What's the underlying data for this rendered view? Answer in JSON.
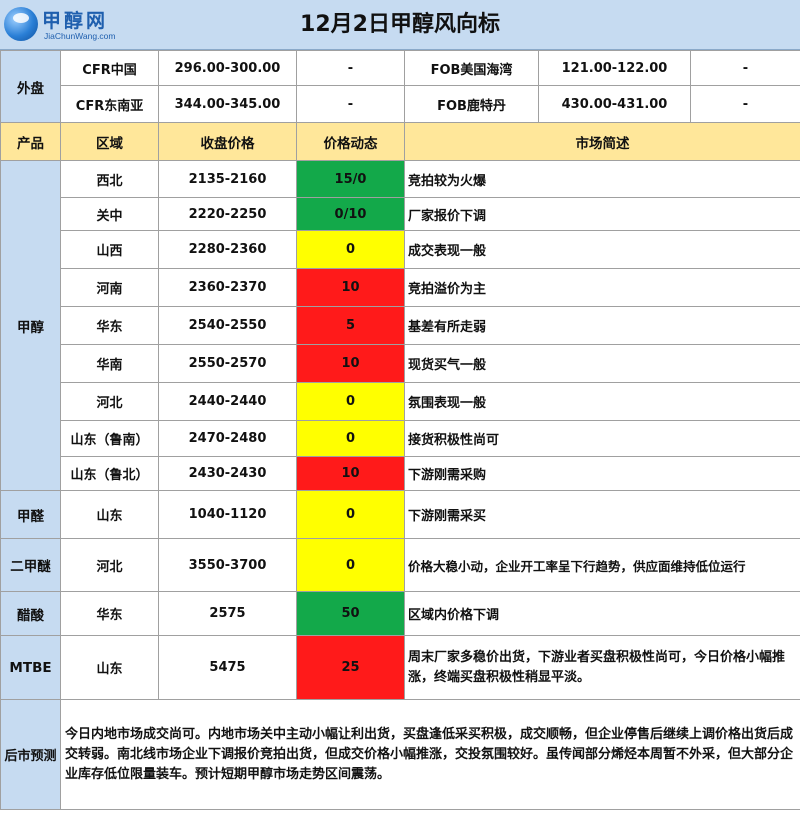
{
  "header": {
    "logo_text": "甲醇网",
    "logo_sub": "JiaChunWang.com",
    "title": "12月2日甲醇风向标"
  },
  "outer": {
    "label": "外盘",
    "rows": [
      {
        "a_name": "CFR中国",
        "a_price": "296.00-300.00",
        "a_change": "-",
        "b_name": "FOB美国海湾",
        "b_price": "121.00-122.00",
        "b_change": "-"
      },
      {
        "a_name": "CFR东南亚",
        "a_price": "344.00-345.00",
        "a_change": "-",
        "b_name": "FOB鹿特丹",
        "b_price": "430.00-431.00",
        "b_change": "-"
      }
    ]
  },
  "columns": {
    "product": "产品",
    "region": "区域",
    "price": "收盘价格",
    "change": "价格动态",
    "comment": "市场简述"
  },
  "products": {
    "methanol": "甲醇",
    "formaldehyde": "甲醛",
    "dme": "二甲醚",
    "acetic": "醋酸",
    "mtbe": "MTBE"
  },
  "rows": [
    {
      "region": "西北",
      "price": "2135-2160",
      "change": "15/0",
      "color": "#13a94a",
      "comment": "竞拍较为火爆"
    },
    {
      "region": "关中",
      "price": "2220-2250",
      "change": "0/10",
      "color": "#13a94a",
      "comment": "厂家报价下调"
    },
    {
      "region": "山西",
      "price": "2280-2360",
      "change": "0",
      "color": "#ffff00",
      "comment": "成交表现一般"
    },
    {
      "region": "河南",
      "price": "2360-2370",
      "change": "10",
      "color": "#ff1a1a",
      "comment": "竞拍溢价为主"
    },
    {
      "region": "华东",
      "price": "2540-2550",
      "change": "5",
      "color": "#ff1a1a",
      "comment": "基差有所走弱"
    },
    {
      "region": "华南",
      "price": "2550-2570",
      "change": "10",
      "color": "#ff1a1a",
      "comment": "现货买气一般"
    },
    {
      "region": "河北",
      "price": "2440-2440",
      "change": "0",
      "color": "#ffff00",
      "comment": "氛围表现一般"
    },
    {
      "region": "山东（鲁南）",
      "price": "2470-2480",
      "change": "0",
      "color": "#ffff00",
      "comment": "接货积极性尚可"
    },
    {
      "region": "山东（鲁北）",
      "price": "2430-2430",
      "change": "10",
      "color": "#ff1a1a",
      "comment": "下游刚需采购"
    },
    {
      "region": "山东",
      "price": "1040-1120",
      "change": "0",
      "color": "#ffff00",
      "comment": "下游刚需采买"
    },
    {
      "region": "河北",
      "price": "3550-3700",
      "change": "0",
      "color": "#ffff00",
      "comment": "价格大稳小动，企业开工率呈下行趋势，供应面维持低位运行"
    },
    {
      "region": "华东",
      "price": "2575",
      "change": "50",
      "color": "#13a94a",
      "comment": "区域内价格下调"
    },
    {
      "region": "山东",
      "price": "5475",
      "change": "25",
      "color": "#ff1a1a",
      "comment": "周末厂家多稳价出货，下游业者买盘积极性尚可，今日价格小幅推涨，终端买盘积极性稍显平淡。"
    }
  ],
  "forecast": {
    "label": "后市预测",
    "text": "今日内地市场成交尚可。内地市场关中主动小幅让利出货，买盘逢低采买积极，成交顺畅，但企业停售后继续上调价格出货后成交转弱。南北线市场企业下调报价竞拍出货，但成交价格小幅推涨，交投氛围较好。虽传闻部分烯烃本周暂不外采，但大部分企业库存低位限量装车。预计短期甲醇市场走势区间震荡。"
  },
  "colors": {
    "header_bg": "#c6dbf1",
    "column_head_bg": "#ffe79a",
    "up_red": "#ff1a1a",
    "flat_yellow": "#ffff00",
    "down_green": "#13a94a"
  }
}
